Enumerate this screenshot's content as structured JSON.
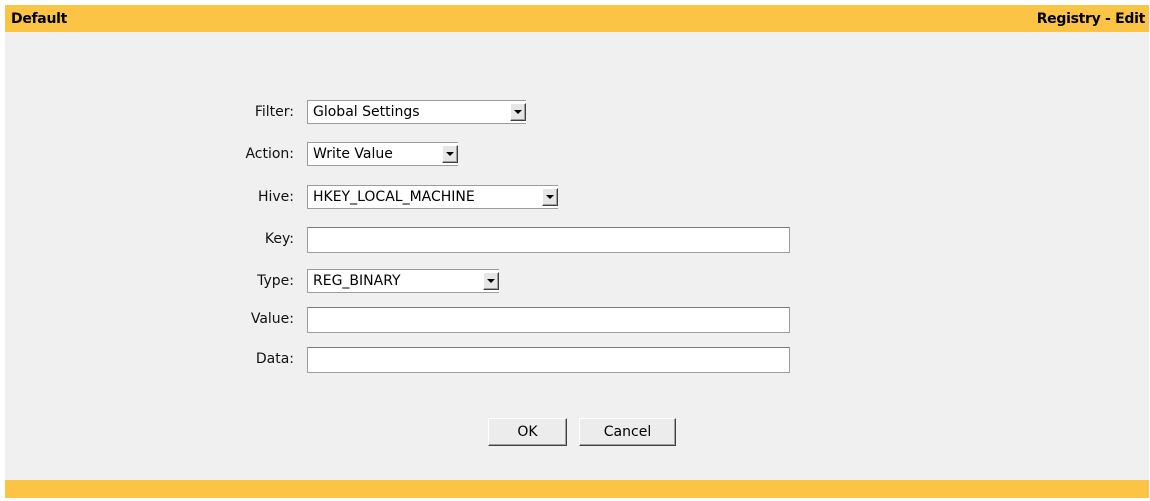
{
  "header": {
    "left_title": "Default",
    "right_title": "Registry - Edit"
  },
  "form": {
    "filter": {
      "label": "Filter:",
      "value": "Global Settings"
    },
    "action": {
      "label": "Action:",
      "value": "Write Value"
    },
    "hive": {
      "label": "Hive:",
      "value": "HKEY_LOCAL_MACHINE"
    },
    "key": {
      "label": "Key:",
      "value": ""
    },
    "type": {
      "label": "Type:",
      "value": "REG_BINARY"
    },
    "value": {
      "label": "Value:",
      "value": ""
    },
    "data": {
      "label": "Data:",
      "value": ""
    }
  },
  "buttons": {
    "ok": "OK",
    "cancel": "Cancel"
  },
  "colors": {
    "accent": "#fcc445",
    "background": "#f0f0f0"
  }
}
